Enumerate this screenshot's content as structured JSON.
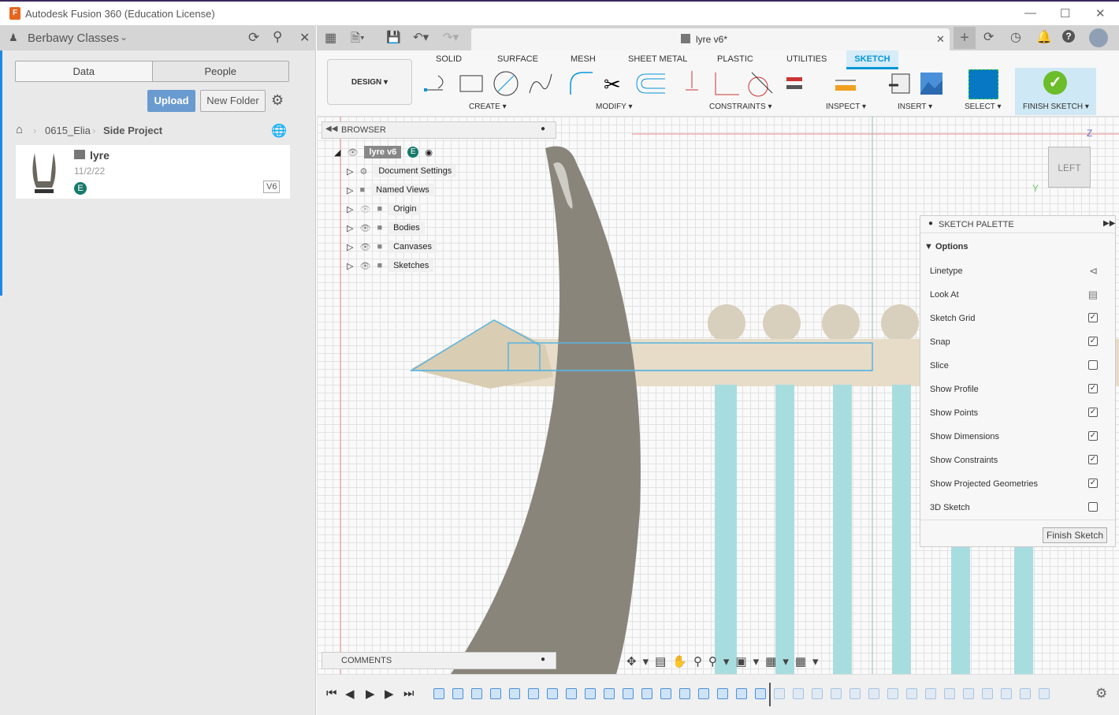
{
  "window": {
    "title": "Autodesk Fusion 360 (Education License)",
    "logo": "F"
  },
  "left_panel": {
    "team": "Berbawy Classes",
    "tabs": [
      "Data",
      "People"
    ],
    "upload": "Upload",
    "new_folder": "New Folder",
    "breadcrumb": [
      "0615_Elia",
      "Side Project"
    ],
    "file": {
      "name": "lyre",
      "date": "11/2/22",
      "badge": "E",
      "version": "V6"
    }
  },
  "document_tab": {
    "title": "lyre v6*"
  },
  "toolbar": {
    "workspace": "DESIGN",
    "tabs": [
      "SOLID",
      "SURFACE",
      "MESH",
      "SHEET METAL",
      "PLASTIC",
      "UTILITIES",
      "SKETCH"
    ],
    "active_tab": "SKETCH",
    "groups": [
      "CREATE",
      "MODIFY",
      "CONSTRAINTS",
      "INSPECT",
      "INSERT",
      "SELECT",
      "FINISH SKETCH"
    ]
  },
  "browser": {
    "title": "BROWSER",
    "root": "lyre v6",
    "root_badge": "E",
    "items": [
      "Document Settings",
      "Named Views",
      "Origin",
      "Bodies",
      "Canvases",
      "Sketches"
    ]
  },
  "viewcube": {
    "face": "LEFT",
    "axis_z": "Z",
    "axis_y": "Y"
  },
  "sketch_palette": {
    "title": "SKETCH PALETTE",
    "section": "Options",
    "rows": [
      {
        "label": "Linetype",
        "type": "icon"
      },
      {
        "label": "Look At",
        "type": "icon"
      },
      {
        "label": "Sketch Grid",
        "checked": true
      },
      {
        "label": "Snap",
        "checked": true
      },
      {
        "label": "Slice",
        "checked": false
      },
      {
        "label": "Show Profile",
        "checked": true
      },
      {
        "label": "Show Points",
        "checked": true
      },
      {
        "label": "Show Dimensions",
        "checked": true
      },
      {
        "label": "Show Constraints",
        "checked": true
      },
      {
        "label": "Show Projected Geometries",
        "checked": true
      },
      {
        "label": "3D Sketch",
        "checked": false
      }
    ],
    "finish": "Finish Sketch"
  },
  "comments": {
    "title": "COMMENTS"
  },
  "colors": {
    "accent": "#0696d7",
    "upload": "#6a9bd0",
    "finish": "#6cbd2a",
    "sketch_line": "#5ab4e0"
  }
}
